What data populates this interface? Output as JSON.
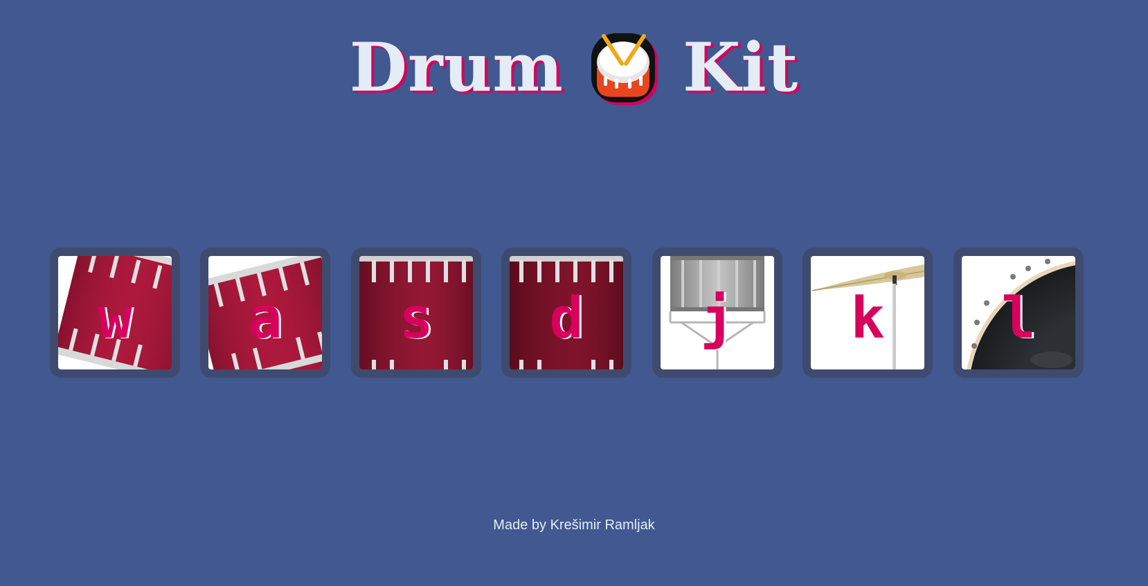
{
  "header": {
    "title_left": "Drum",
    "title_right": "Kit",
    "icon": "drum-emoji-icon"
  },
  "drums": [
    {
      "key": "w",
      "instrument": "tom-1"
    },
    {
      "key": "a",
      "instrument": "tom-2"
    },
    {
      "key": "s",
      "instrument": "tom-3"
    },
    {
      "key": "d",
      "instrument": "tom-4"
    },
    {
      "key": "j",
      "instrument": "snare"
    },
    {
      "key": "k",
      "instrument": "crash"
    },
    {
      "key": "l",
      "instrument": "kick-bass"
    }
  ],
  "footer": {
    "text": "Made by Krešimir Ramljak"
  },
  "colors": {
    "background": "#415890",
    "accent": "#d8005d",
    "title": "#e4ecf6",
    "button_frame": "#3f4b6e"
  }
}
